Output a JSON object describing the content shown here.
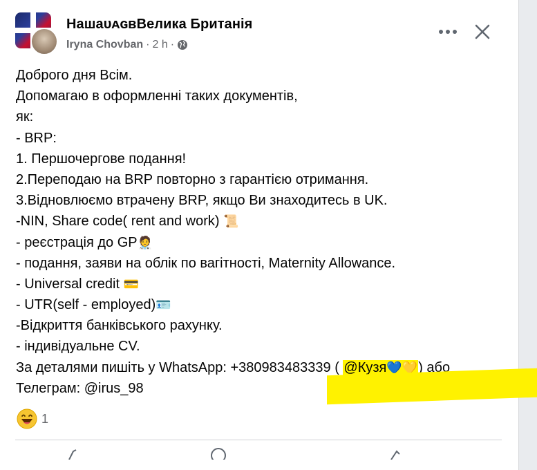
{
  "post": {
    "group_name": "НашаᴜᴀɢʙВелика Британія",
    "author": "Iryna Chovban",
    "time": "2 h",
    "separator": "·",
    "lines": [
      "Доброго дня Всім.",
      "Допомагаю в оформленні таких документів,",
      "як:",
      "- BRP:",
      "1. Першочергове подання!",
      "2.Переподаю на BRP повторно з гарантією отримання.",
      "3.Відновлюємо втрачену BRP, якщо Ви знаходитесь в UK.",
      "-NIN, Share code( rent and work) ",
      "- реєстрація до GP",
      "- подання, заяви на облік по вагітності,  Maternity Allowance.",
      "- Universal credit ",
      "- UTR(self - employed)",
      "-Відкриття банківського рахунку.",
      "- індивідуальне CV.",
      "За деталями пишіть у WhatsApp: +380983483339 ( ",
      "Телеграм: @irus_98"
    ],
    "emojis": {
      "scroll": "📜",
      "doctor": "🧑‍⚕️",
      "card": "💳",
      "id_card": "🪪",
      "hearts": "💙💛"
    },
    "mention": "@Кузя",
    "after_mention": ") або"
  },
  "reactions": {
    "count": "1",
    "icon": "laughing-face-icon"
  },
  "colors": {
    "highlight": "#fff200",
    "text": "#050505",
    "muted": "#65676b"
  }
}
